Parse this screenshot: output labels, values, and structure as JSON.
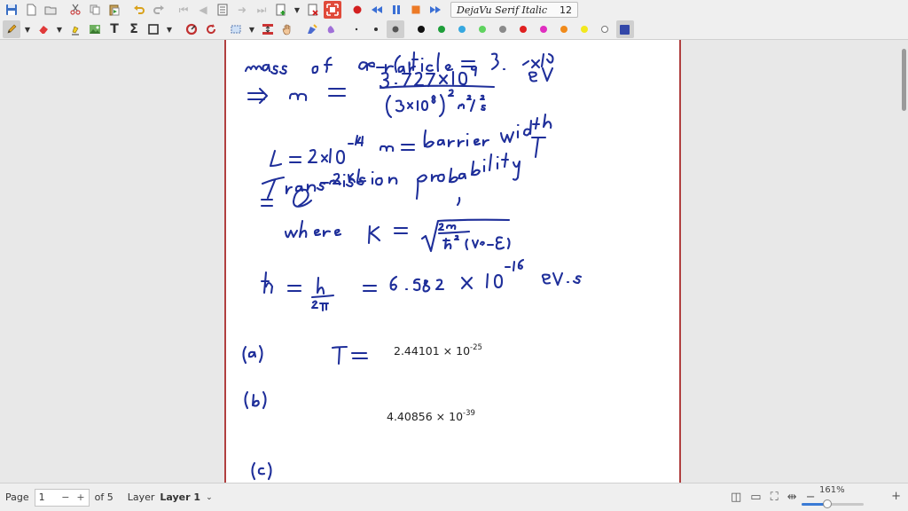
{
  "toolbar1": {
    "font_name": "DejaVu Serif Italic",
    "font_size": "12"
  },
  "toolbar2": {
    "colors": [
      {
        "name": "black",
        "hex": "#111111"
      },
      {
        "name": "green",
        "hex": "#1e9e3a"
      },
      {
        "name": "light-blue",
        "hex": "#36a8e0"
      },
      {
        "name": "light-green",
        "hex": "#5fd35f"
      },
      {
        "name": "gray",
        "hex": "#8a8a8a"
      },
      {
        "name": "red",
        "hex": "#e02020"
      },
      {
        "name": "magenta",
        "hex": "#e02ec0"
      },
      {
        "name": "orange",
        "hex": "#f08a1a"
      },
      {
        "name": "yellow",
        "hex": "#f2e81e"
      },
      {
        "name": "white",
        "hex": "#ffffff"
      },
      {
        "name": "navy",
        "hex": "#3347a8"
      }
    ],
    "ink_color": "#1f2f9a"
  },
  "page": {
    "typed_a_base": "2.44101 × 10",
    "typed_a_exp": "-25",
    "typed_b_base": "4.40856 × 10",
    "typed_b_exp": "-39"
  },
  "status": {
    "page_label": "Page",
    "page_value": "1",
    "page_minus": "−",
    "page_plus": "+",
    "of_pages": "of 5",
    "layer_label": "Layer",
    "layer_value": "Layer 1",
    "zoom": "161%",
    "zoom_fraction": 0.42
  }
}
